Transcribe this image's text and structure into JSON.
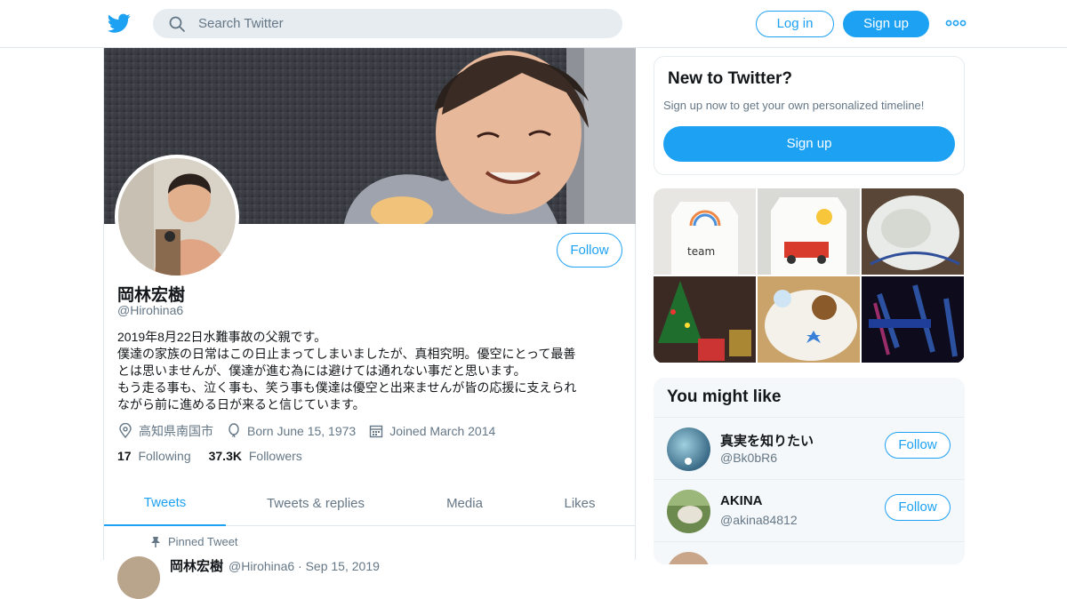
{
  "colors": {
    "accent": "#1da1f2",
    "text": "#14171a",
    "secondary": "#657786",
    "border": "#e6ecf0"
  },
  "header": {
    "logo_icon": "twitter-bird-icon",
    "search_placeholder": "Search Twitter",
    "login_label": "Log in",
    "signup_label": "Sign up",
    "more_icon": "more-dots-icon"
  },
  "profile": {
    "name": "岡林宏樹",
    "handle": "@Hirohina6",
    "follow_label": "Follow",
    "bio": [
      "2019年8月22日水難事故の父親です。",
      "僕達の家族の日常はこの日止まってしまいましたが、真相究明。優空にとって最善",
      "とは思いませんが、僕達が進む為には避けては通れない事だと思います。",
      "もう走る事も、泣く事も、笑う事も僕達は優空と出来ませんが皆の応援に支えられ",
      "ながら前に進める日が来ると信じています。"
    ],
    "location": "高知県南国市",
    "born": "Born June 15, 1973",
    "joined": "Joined March 2014",
    "following_count": "17",
    "following_label": "Following",
    "followers_count": "37.3K",
    "followers_label": "Followers"
  },
  "tabs": [
    {
      "label": "Tweets",
      "active": true
    },
    {
      "label": "Tweets & replies",
      "active": false
    },
    {
      "label": "Media",
      "active": false
    },
    {
      "label": "Likes",
      "active": false
    }
  ],
  "pinned": {
    "label": "Pinned Tweet",
    "author": "岡林宏樹",
    "meta": "@Hirohina6 · Sep 15, 2019"
  },
  "sidebar": {
    "new_title": "New to Twitter?",
    "new_text": "Sign up now to get your own personalized timeline!",
    "new_signup": "Sign up",
    "might_like_title": "You might like",
    "suggestions": [
      {
        "name": "真実を知りたい",
        "handle": "@Bk0bR6",
        "follow": "Follow"
      },
      {
        "name": "AKINA",
        "handle": "@akina84812",
        "follow": "Follow"
      }
    ]
  }
}
